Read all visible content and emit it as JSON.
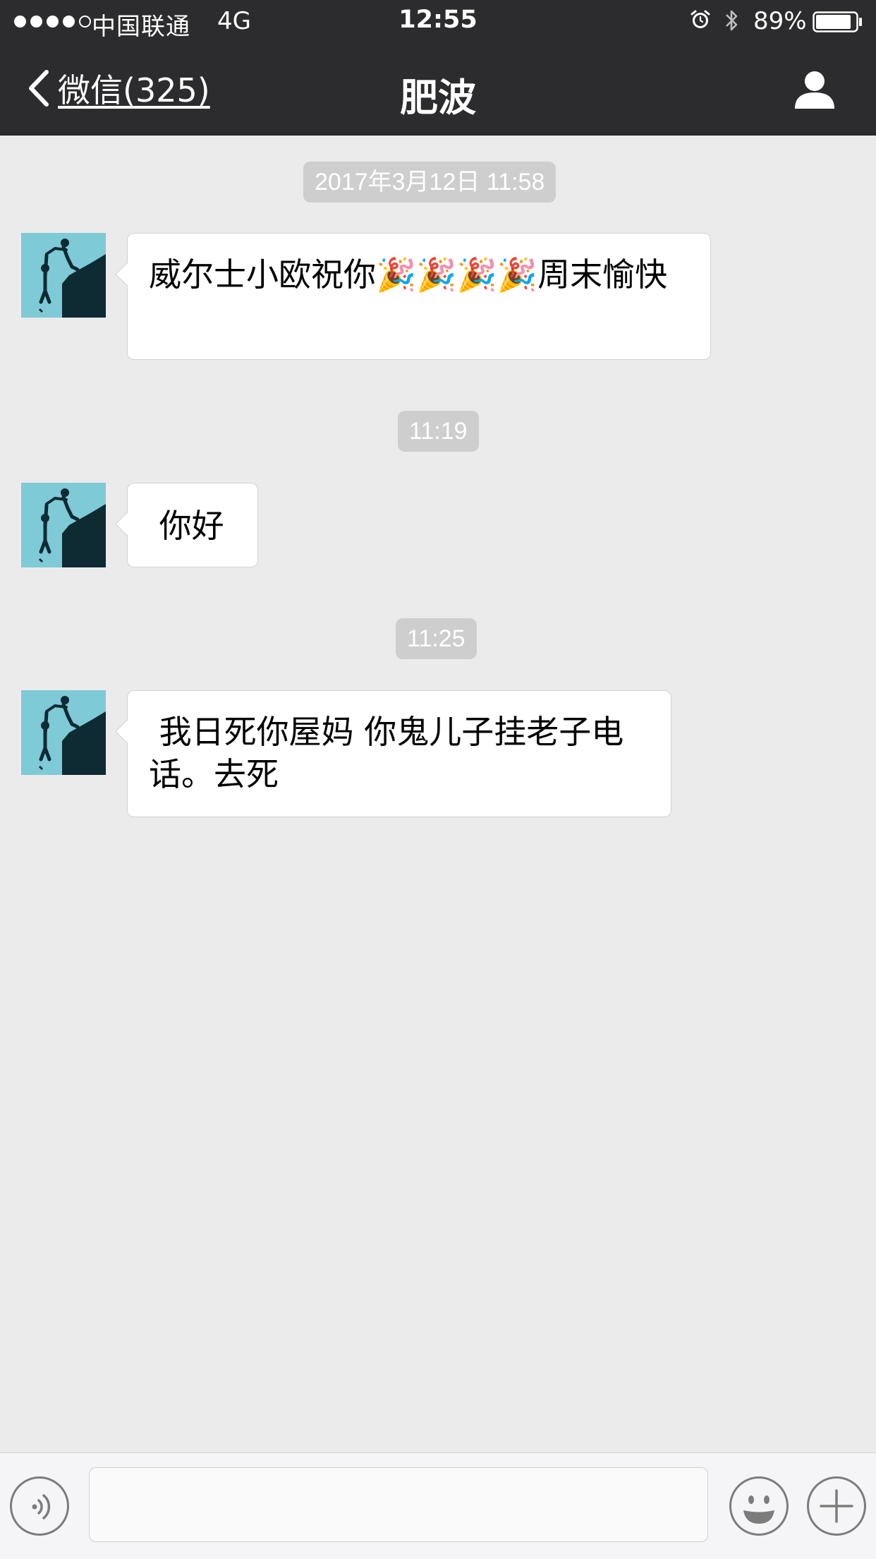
{
  "status_bar": {
    "carrier": "中国联通",
    "network": "4G",
    "time": "12:55",
    "battery": "89%",
    "battery_level": 0.89,
    "signal_bars": 4,
    "signal_max": 5,
    "icons": [
      "signal-dots",
      "alarm-icon",
      "bluetooth-icon",
      "battery-icon"
    ]
  },
  "nav": {
    "back_label": "微信(325)",
    "title": "肥波",
    "right_icon": "profile-icon"
  },
  "messages": [
    {
      "type": "time",
      "text": "2017年3月12日 11:58"
    },
    {
      "type": "incoming",
      "text": "威尔士小欧祝你🎉🎉🎉🎉周末愉快"
    },
    {
      "type": "time",
      "text": "11:19"
    },
    {
      "type": "incoming",
      "text": " 你好"
    },
    {
      "type": "time",
      "text": "11:25"
    },
    {
      "type": "incoming",
      "text": " 我日死你屋妈 你鬼儿子挂老子电话。去死"
    }
  ],
  "input_bar": {
    "value": "",
    "left_icon": "voice-icon",
    "emoji_icon": "emoji-icon",
    "plus_icon": "plus-icon"
  },
  "colors": {
    "bar_bg": "#2c2c2e",
    "chat_bg": "#ebebeb",
    "time_badge_bg": "#cecece",
    "bubble_bg": "#ffffff"
  }
}
